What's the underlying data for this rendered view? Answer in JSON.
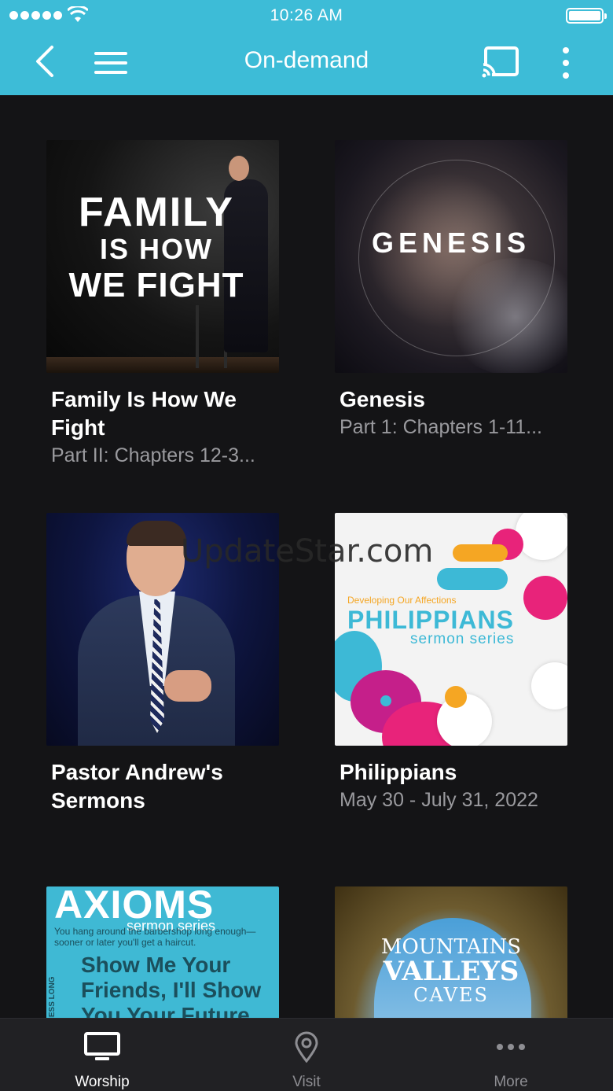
{
  "status_bar": {
    "time": "10:26 AM"
  },
  "header": {
    "title": "On-demand"
  },
  "items": [
    {
      "title": "Family Is How We Fight",
      "subtitle": "Part II: Chapters 12-3...",
      "art": {
        "line1": "FAMILY",
        "line2": "IS HOW",
        "line3": "WE FIGHT"
      }
    },
    {
      "title": "Genesis",
      "subtitle": "Part 1: Chapters 1-11...",
      "art": {
        "line1": "GENESIS"
      }
    },
    {
      "title": "Pastor Andrew's Sermons",
      "subtitle": ""
    },
    {
      "title": "Philippians",
      "subtitle": "May 30 - July 31, 2022",
      "art": {
        "kicker": "Developing Our Affections",
        "line1": "PHILIPPIANS",
        "line2": "sermon series"
      }
    },
    {
      "title": "",
      "subtitle": "",
      "art": {
        "line1": "AXIOMS",
        "line2": "sermon series",
        "quote": "You hang around the barbershop long enough—sooner or later you'll get a haircut.",
        "quote2": "Show Me Your Friends, I'll Show You Your Future",
        "side": "AWARENESS LONG WAY"
      }
    },
    {
      "title": "",
      "subtitle": "",
      "art": {
        "line1": "MOUNTAINS",
        "line2": "VALLEYS",
        "line3": "CAVES"
      }
    }
  ],
  "watermark": "UpdateStar.com",
  "tabbar": {
    "tabs": [
      {
        "label": "Worship",
        "icon": "tv-icon",
        "active": true
      },
      {
        "label": "Visit",
        "icon": "location-pin-icon",
        "active": false
      },
      {
        "label": "More",
        "icon": "more-dots-icon",
        "active": false
      }
    ]
  },
  "colors": {
    "header_bg": "#3dbcd7",
    "page_bg": "#141416",
    "tabbar_bg": "#212124",
    "subtitle": "#9a9a9e"
  }
}
